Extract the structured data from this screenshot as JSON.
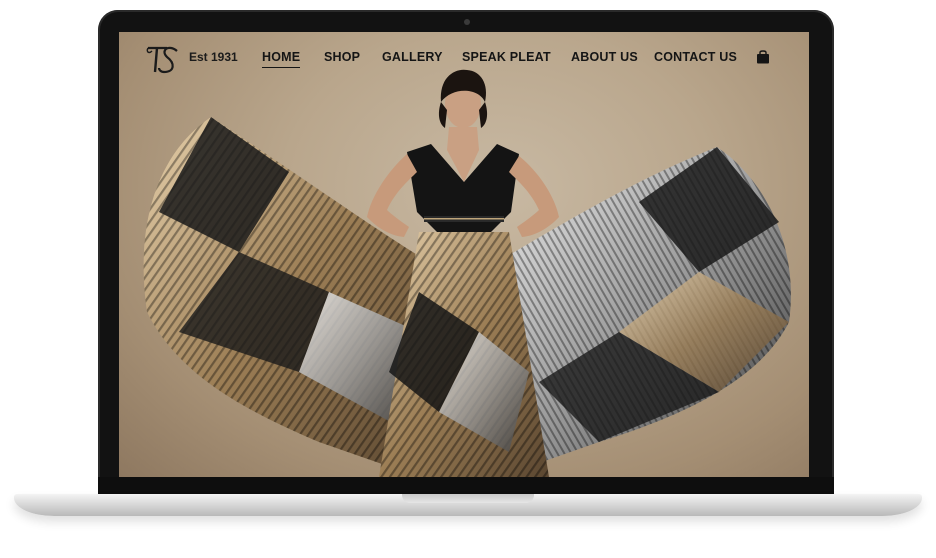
{
  "brand": {
    "logo_text": "TS",
    "est_label": "Est 1931"
  },
  "nav": {
    "items": [
      {
        "label": "HOME",
        "active": true
      },
      {
        "label": "SHOP",
        "active": false
      },
      {
        "label": "GALLERY",
        "active": false
      },
      {
        "label": "SPEAK PLEAT",
        "active": false
      },
      {
        "label": "ABOUT US",
        "active": false
      },
      {
        "label": "CONTACT US",
        "active": false
      }
    ],
    "cart_icon": "shopping-bag-icon"
  },
  "hero": {
    "subject": "hero-fashion-photo"
  },
  "colors": {
    "backdrop": "#b9a68c",
    "nav_text": "#151515",
    "laptop_bezel": "#121212",
    "laptop_base": "#dcdcdc"
  }
}
